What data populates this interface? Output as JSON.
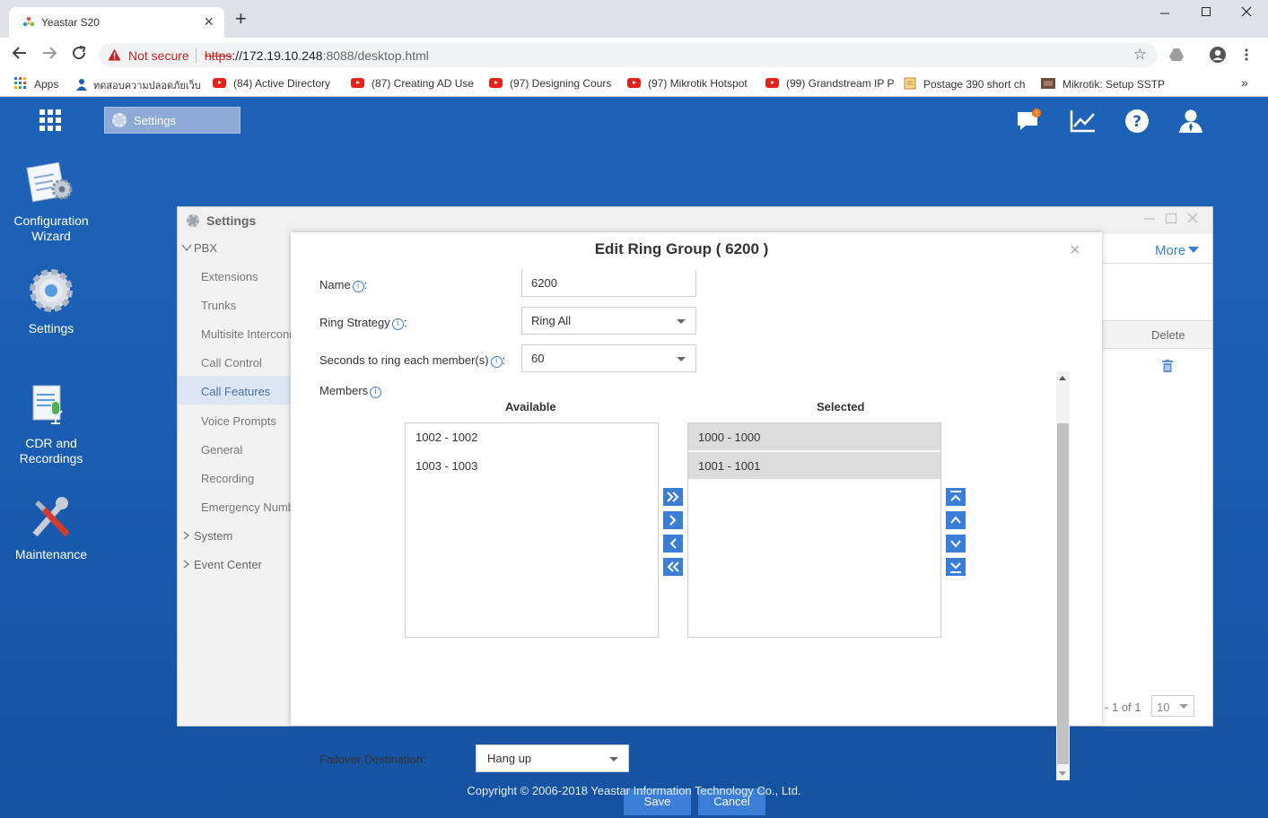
{
  "browser": {
    "tab_title": "Yeastar S20",
    "tab_close": "×",
    "new_tab": "+",
    "security_label": "Not secure",
    "url_scheme": "https",
    "url_host": "://172.19.10.248",
    "url_rest": ":8088/desktop.html",
    "bookmarks": [
      "Apps",
      "ทดสอบความปลอดภัยเว็บ",
      "(84) Active Directory",
      "(87) Creating AD Use",
      "(97) Designing Cours",
      "(97) Mikrotik Hotspot",
      "(99) Grandstream IP P",
      "Postage 390 short ch",
      "Mikrotik: Setup SSTP"
    ],
    "bookmarks_more": "»"
  },
  "appbar": {
    "taskbar_item": "Settings"
  },
  "desktop_icons": [
    {
      "label_line1": "Configuration",
      "label_line2": "Wizard"
    },
    {
      "label_line1": "Settings",
      "label_line2": ""
    },
    {
      "label_line1": "CDR and",
      "label_line2": "Recordings"
    },
    {
      "label_line1": "Maintenance",
      "label_line2": ""
    }
  ],
  "settings_window": {
    "title": "Settings",
    "nav": {
      "pbx": "PBX",
      "items": [
        "Extensions",
        "Trunks",
        "Multisite Interconn",
        "Call Control",
        "Call Features",
        "Voice Prompts",
        "General",
        "Recording",
        "Emergency Numb"
      ],
      "system": "System",
      "event_center": "Event Center"
    },
    "more_label": "More",
    "delete_header": "Delete",
    "pager_text": "- 1 of 1",
    "page_size": "10"
  },
  "modal": {
    "title": "Edit Ring Group ( 6200 )",
    "close": "×",
    "info_glyph": "i",
    "name_label": "Name",
    "name_value": "6200",
    "strategy_label": "Ring Strategy",
    "strategy_value": "Ring All",
    "seconds_label": "Seconds to ring each member(s)",
    "seconds_value": "60",
    "members_label": "Members",
    "colon": ":",
    "available_header": "Available",
    "selected_header": "Selected",
    "available": [
      "1002 - 1002",
      "1003 - 1003"
    ],
    "selected": [
      "1000 - 1000",
      "1001 - 1001"
    ],
    "failover_label": "Failover Destination:",
    "failover_value": "Hang up",
    "save": "Save",
    "cancel": "Cancel"
  },
  "footer": {
    "copyright": "Copyright © 2006-2018 Yeastar Information Technology Co., Ltd."
  },
  "colors": {
    "accent": "#3b7ed7",
    "desktop_bg": "#1e63b8",
    "danger": "#c5221f"
  }
}
